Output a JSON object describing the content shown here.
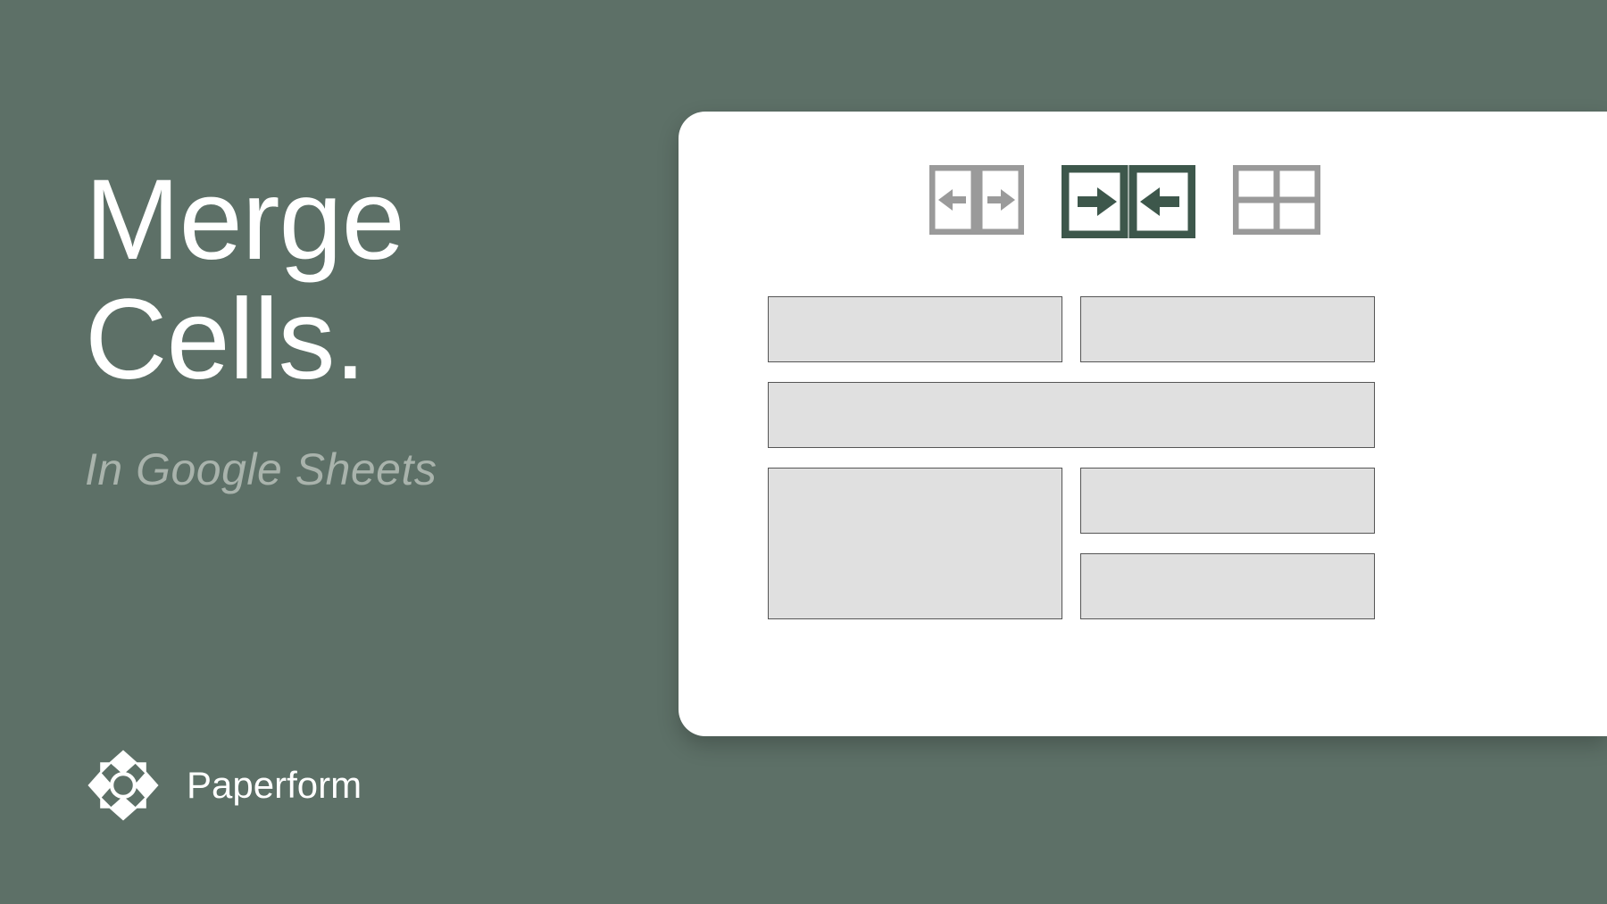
{
  "title_line1": "Merge",
  "title_line2": "Cells.",
  "subtitle": "In Google Sheets",
  "brand": "Paperform",
  "colors": {
    "background": "#5d7067",
    "card": "#ffffff",
    "cell_fill": "#e0e0e0",
    "icon_active": "#3d574b",
    "icon_inactive": "#9a9a9a"
  },
  "toolbar": {
    "unmerge": "unmerge-cells",
    "merge_horizontal": "merge-horizontal",
    "grid": "grid-cells"
  }
}
